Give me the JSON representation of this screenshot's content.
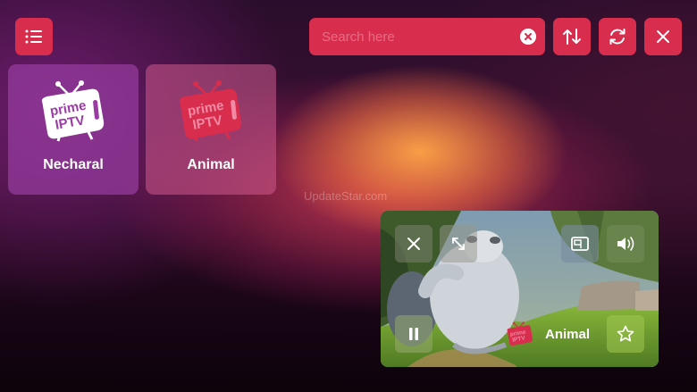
{
  "header": {
    "search_placeholder": "Search here",
    "search_value": ""
  },
  "channels": [
    {
      "name": "Necharal",
      "logo_text_1": "prime",
      "logo_text_2": "IPTV"
    },
    {
      "name": "Animal",
      "logo_text_1": "prime",
      "logo_text_2": "IPTV"
    }
  ],
  "watermark": "UpdateStar.com",
  "player": {
    "channel_name": "Animal",
    "logo_text_1": "prime",
    "logo_text_2": "IPTV",
    "state": "playing"
  },
  "icons": {
    "menu": "menu-icon",
    "clear": "clear-search-icon",
    "sort": "sort-icon",
    "refresh": "refresh-icon",
    "close": "close-icon",
    "player_close": "close-icon",
    "player_expand": "expand-icon",
    "player_pip": "picture-in-picture-icon",
    "player_volume": "volume-icon",
    "player_pause": "pause-icon",
    "player_favorite": "star-icon"
  },
  "colors": {
    "accent": "#d92d4d",
    "card_necharal": "#9a3ca4",
    "card_animal": "#cd5a8c",
    "text": "#ffffff"
  }
}
